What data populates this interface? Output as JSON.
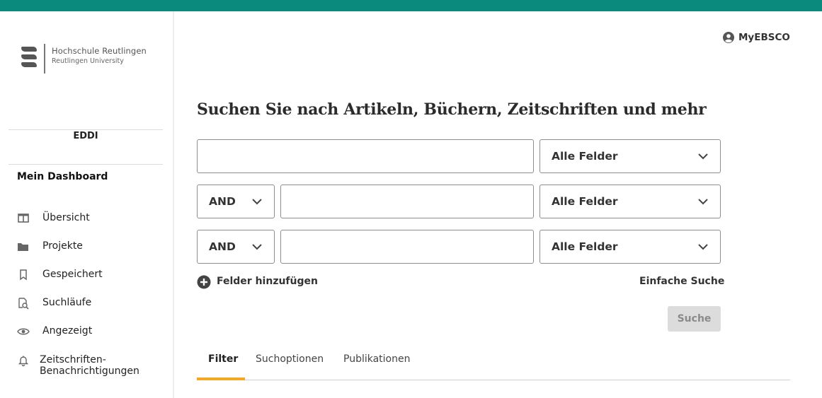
{
  "logo": {
    "name": "Hochschule Reutlingen",
    "subtitle": "Reutlingen University"
  },
  "sidebar": {
    "section_label": "EDDI",
    "dashboard_title": "Mein Dashboard",
    "items": [
      {
        "label": "Übersicht",
        "icon": "columns-icon"
      },
      {
        "label": "Projekte",
        "icon": "folder-icon"
      },
      {
        "label": "Gespeichert",
        "icon": "bookmark-icon"
      },
      {
        "label": "Suchläufe",
        "icon": "search-history-icon"
      },
      {
        "label": "Angezeigt",
        "icon": "eye-icon"
      },
      {
        "label": "Zeitschriften-",
        "label2": "Benachrichtigungen",
        "icon": "bell-icon"
      }
    ]
  },
  "header": {
    "account_label": "MyEBSCO"
  },
  "search": {
    "heading": "Suchen Sie nach Artikeln, Büchern, Zeitschriften und mehr",
    "rows": [
      {
        "value": "",
        "field": "Alle Felder"
      },
      {
        "operator": "AND",
        "value": "",
        "field": "Alle Felder"
      },
      {
        "operator": "AND",
        "value": "",
        "field": "Alle Felder"
      }
    ],
    "add_fields_label": "Felder hinzufügen",
    "simple_search_label": "Einfache Suche",
    "submit_label": "Suche"
  },
  "tabs": [
    {
      "label": "Filter",
      "active": true
    },
    {
      "label": "Suchoptionen",
      "active": false
    },
    {
      "label": "Publikationen",
      "active": false
    }
  ],
  "colors": {
    "top_bar": "#0a8a7c",
    "tab_accent": "#f5a623",
    "disabled_button": "#dcdcdc"
  }
}
